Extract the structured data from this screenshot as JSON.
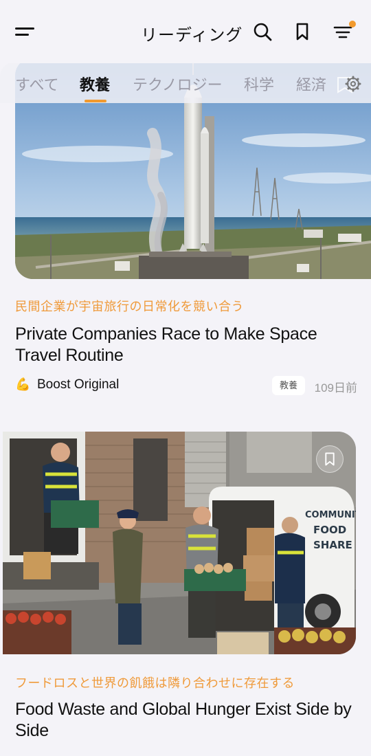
{
  "header": {
    "title": "リーディング",
    "icons": [
      "menu-icon",
      "search-icon",
      "bookmark-icon",
      "filter-icon"
    ],
    "notification_dot_color": "#f29a2e"
  },
  "tabs": [
    {
      "label": "すべて",
      "active": false
    },
    {
      "label": "教養",
      "active": true
    },
    {
      "label": "テクノロジー",
      "active": false
    },
    {
      "label": "科学",
      "active": false
    },
    {
      "label": "経済",
      "active": false
    }
  ],
  "accent_color": "#f29a2e",
  "articles": [
    {
      "subtitle": "民間企業が宇宙旅行の日常化を競い合う",
      "title": "Private Companies Race to Make Space Travel Routine",
      "source_emoji": "💪",
      "source": "Boost Original",
      "category": "教養",
      "time": "109日前"
    },
    {
      "subtitle": "フードロスと世界の飢餓は隣り合わせに存在する",
      "title": "Food Waste and Global Hunger Exist Side by Side",
      "van_text": "COMMUNITY FOOD SHARE"
    }
  ]
}
